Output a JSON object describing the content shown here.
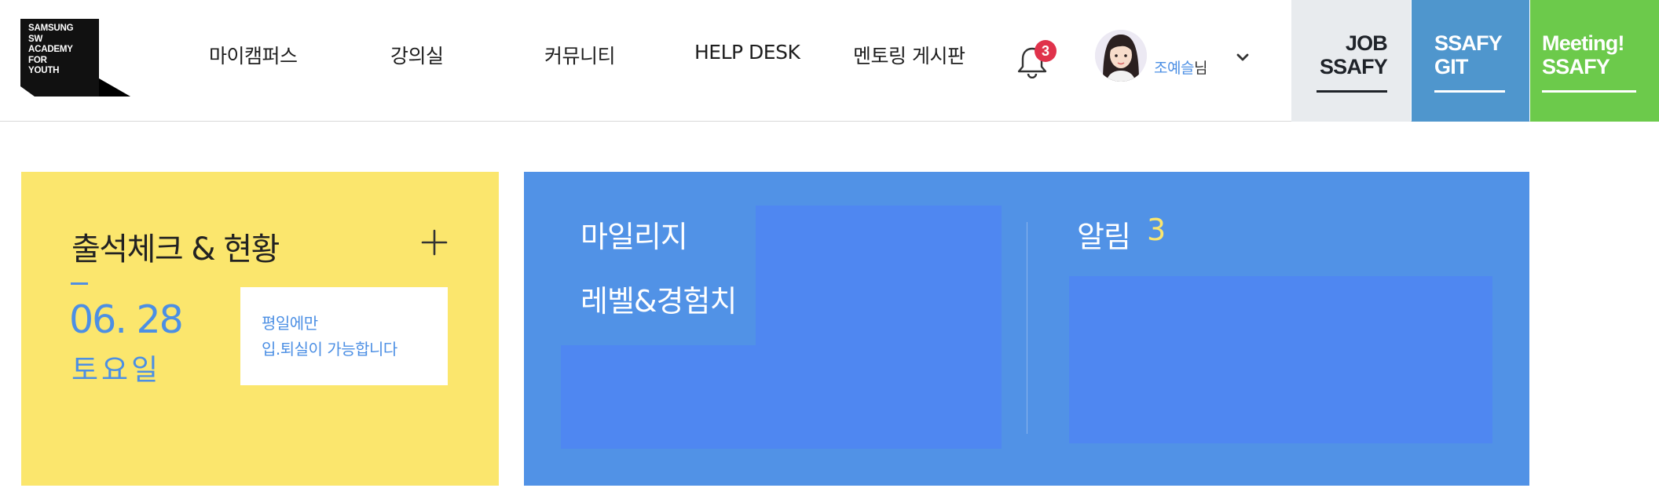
{
  "logo": {
    "lines": [
      "SAMSUNG",
      "SW",
      "ACADEMY",
      "FOR",
      "YOUTH"
    ]
  },
  "nav": {
    "items": [
      "마이캠퍼스",
      "강의실",
      "커뮤니티",
      "HELP DESK",
      "멘토링 게시판"
    ]
  },
  "notifications": {
    "badge_count": "3"
  },
  "user": {
    "name": "조예슬",
    "suffix": "님"
  },
  "side_buttons": {
    "job": {
      "line1": "JOB",
      "line2": "SSAFY",
      "bg": "#e8ebee"
    },
    "git": {
      "line1": "SSAFY",
      "line2": "GIT",
      "bg": "#4f96cd"
    },
    "meeting": {
      "line1": "Meeting!",
      "line2": "SSAFY",
      "bg": "#6cca4b"
    }
  },
  "attendance": {
    "title": "출석체크 & 현황",
    "date": "06. 28",
    "day": "토요일",
    "note_line1": "평일에만",
    "note_line2": "입.퇴실이 가능합니다",
    "bg": "#fbe66d"
  },
  "mileage": {
    "title": "마일리지",
    "level_title": "레벨&경험치"
  },
  "alerts": {
    "title": "알림",
    "count": "3"
  },
  "colors": {
    "accent_blue": "#4c8fe4",
    "panel_blue": "#5192e6",
    "badge_red": "#e0324b"
  },
  "icons": {
    "bell": "bell-icon",
    "chevron": "chevron-down-icon",
    "plus": "plus-icon"
  }
}
